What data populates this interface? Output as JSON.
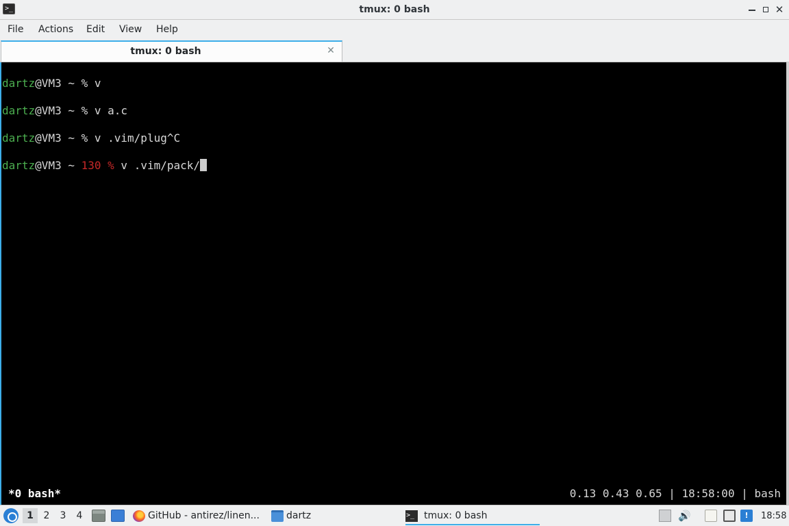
{
  "window": {
    "title": "tmux: 0 bash",
    "icon": "terminal-icon",
    "controls": [
      "minimize-icon",
      "maximize-icon",
      "close-icon"
    ],
    "close_glyph": "✕"
  },
  "menu": {
    "file": "File",
    "actions": "Actions",
    "edit": "Edit",
    "view": "View",
    "help": "Help"
  },
  "tab": {
    "label": "tmux: 0 bash",
    "close_glyph": "✕"
  },
  "terminal": {
    "lines": [
      {
        "user": "dartz",
        "host": "@VM3 ~ ",
        "prompt": "% ",
        "command": "v"
      },
      {
        "user": "dartz",
        "host": "@VM3 ~ ",
        "prompt": "% ",
        "command": "v a.c"
      },
      {
        "user": "dartz",
        "host": "@VM3 ~ ",
        "prompt": "% ",
        "command": "v .vim/plug^C"
      },
      {
        "user": "dartz",
        "host": "@VM3 ~ ",
        "exit_code": "130",
        "prompt": " % ",
        "command": "v .vim/pack/"
      }
    ],
    "status_left": "*0 bash*",
    "status_right": "0.13 0.43 0.65 | 18:58:00 | bash",
    "colors": {
      "user": "#4caf50",
      "exit_code": "#c62828",
      "text": "#d8d8d8"
    }
  },
  "taskbar": {
    "start_icon": "start-menu-icon",
    "workspaces": [
      "1",
      "2",
      "3",
      "4"
    ],
    "active_workspace": "1",
    "quicklaunch": [
      "file-manager-icon",
      "show-desktop-icon"
    ],
    "tasks": [
      {
        "label": "GitHub - antirez/linen...",
        "icon": "firefox-icon"
      },
      {
        "label": "dartz",
        "icon": "folder-icon"
      },
      {
        "label": "tmux: 0 bash",
        "icon": "terminal-icon",
        "active": true
      }
    ],
    "tray": [
      "tray-arrow-icon",
      "volume-icon",
      "clipboard-icon",
      "network-icon",
      "notification-icon"
    ],
    "clock": "18:58"
  }
}
